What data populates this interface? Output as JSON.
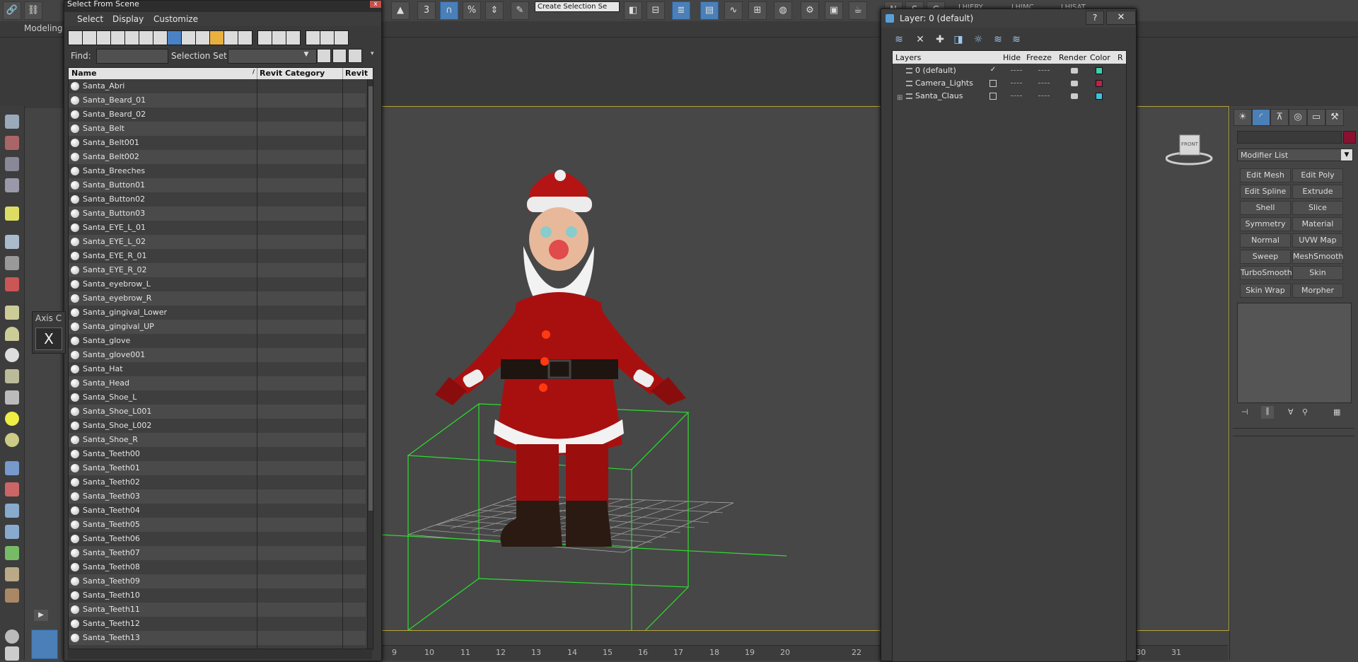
{
  "toolbar": {
    "selection_set_dropdown": "Create Selection Se",
    "ribbon_tab": "Modeling",
    "right_labels": [
      "LHIERY",
      "LHIMC",
      "LHISAT"
    ]
  },
  "select_from_scene": {
    "title": "Select From Scene",
    "close_label": "x",
    "menus": [
      "Select",
      "Display",
      "Customize"
    ],
    "find_label": "Find:",
    "find_value": "",
    "selection_set_label": "Selection Set:",
    "selection_set_value": "",
    "columns": [
      "Name",
      "Revit Category",
      "Revit"
    ],
    "items": [
      "Santa_Abri",
      "Santa_Beard_01",
      "Santa_Beard_02",
      "Santa_Belt",
      "Santa_Belt001",
      "Santa_Belt002",
      "Santa_Breeches",
      "Santa_Button01",
      "Santa_Button02",
      "Santa_Button03",
      "Santa_EYE_L_01",
      "Santa_EYE_L_02",
      "Santa_EYE_R_01",
      "Santa_EYE_R_02",
      "Santa_eyebrow_L",
      "Santa_eyebrow_R",
      "Santa_gingival_Lower",
      "Santa_gingival_UP",
      "Santa_glove",
      "Santa_glove001",
      "Santa_Hat",
      "Santa_Head",
      "Santa_Shoe_L",
      "Santa_Shoe_L001",
      "Santa_Shoe_L002",
      "Santa_Shoe_R",
      "Santa_Teeth00",
      "Santa_Teeth01",
      "Santa_Teeth02",
      "Santa_Teeth03",
      "Santa_Teeth04",
      "Santa_Teeth05",
      "Santa_Teeth06",
      "Santa_Teeth07",
      "Santa_Teeth08",
      "Santa_Teeth09",
      "Santa_Teeth10",
      "Santa_Teeth11",
      "Santa_Teeth12",
      "Santa_Teeth13"
    ]
  },
  "axis_panel": {
    "title": "Axis C",
    "button": "X"
  },
  "layer_dialog": {
    "title": "Layer: 0 (default)",
    "help_label": "?",
    "close_label": "✕",
    "columns": [
      "Layers",
      "Hide",
      "Freeze",
      "Render",
      "Color",
      "R"
    ],
    "layers": [
      {
        "name": "0 (default)",
        "check": "✓",
        "color": "#3fd0b0"
      },
      {
        "name": "Camera_Lights",
        "check": "",
        "color": "#c0204c"
      },
      {
        "name": "Santa_Claus",
        "check": "",
        "color": "#3fc0e0"
      }
    ]
  },
  "command_panel": {
    "modifier_list": "Modifier List",
    "object_color": "#8a1030",
    "modifiers": [
      "Edit Mesh",
      "Edit Poly",
      "Edit Spline",
      "Extrude",
      "Shell",
      "Slice",
      "Symmetry",
      "Material",
      "Normal",
      "UVW Map",
      "Sweep",
      "MeshSmooth",
      "TurboSmooth",
      "Skin",
      "Skin Wrap",
      "Morpher"
    ]
  },
  "timeline": {
    "ticks": [
      "9",
      "10",
      "11",
      "12",
      "13",
      "14",
      "15",
      "16",
      "17",
      "18",
      "19",
      "20",
      "22",
      "30",
      "31"
    ]
  },
  "viewport": {
    "viewcube_label": "FRONT"
  }
}
